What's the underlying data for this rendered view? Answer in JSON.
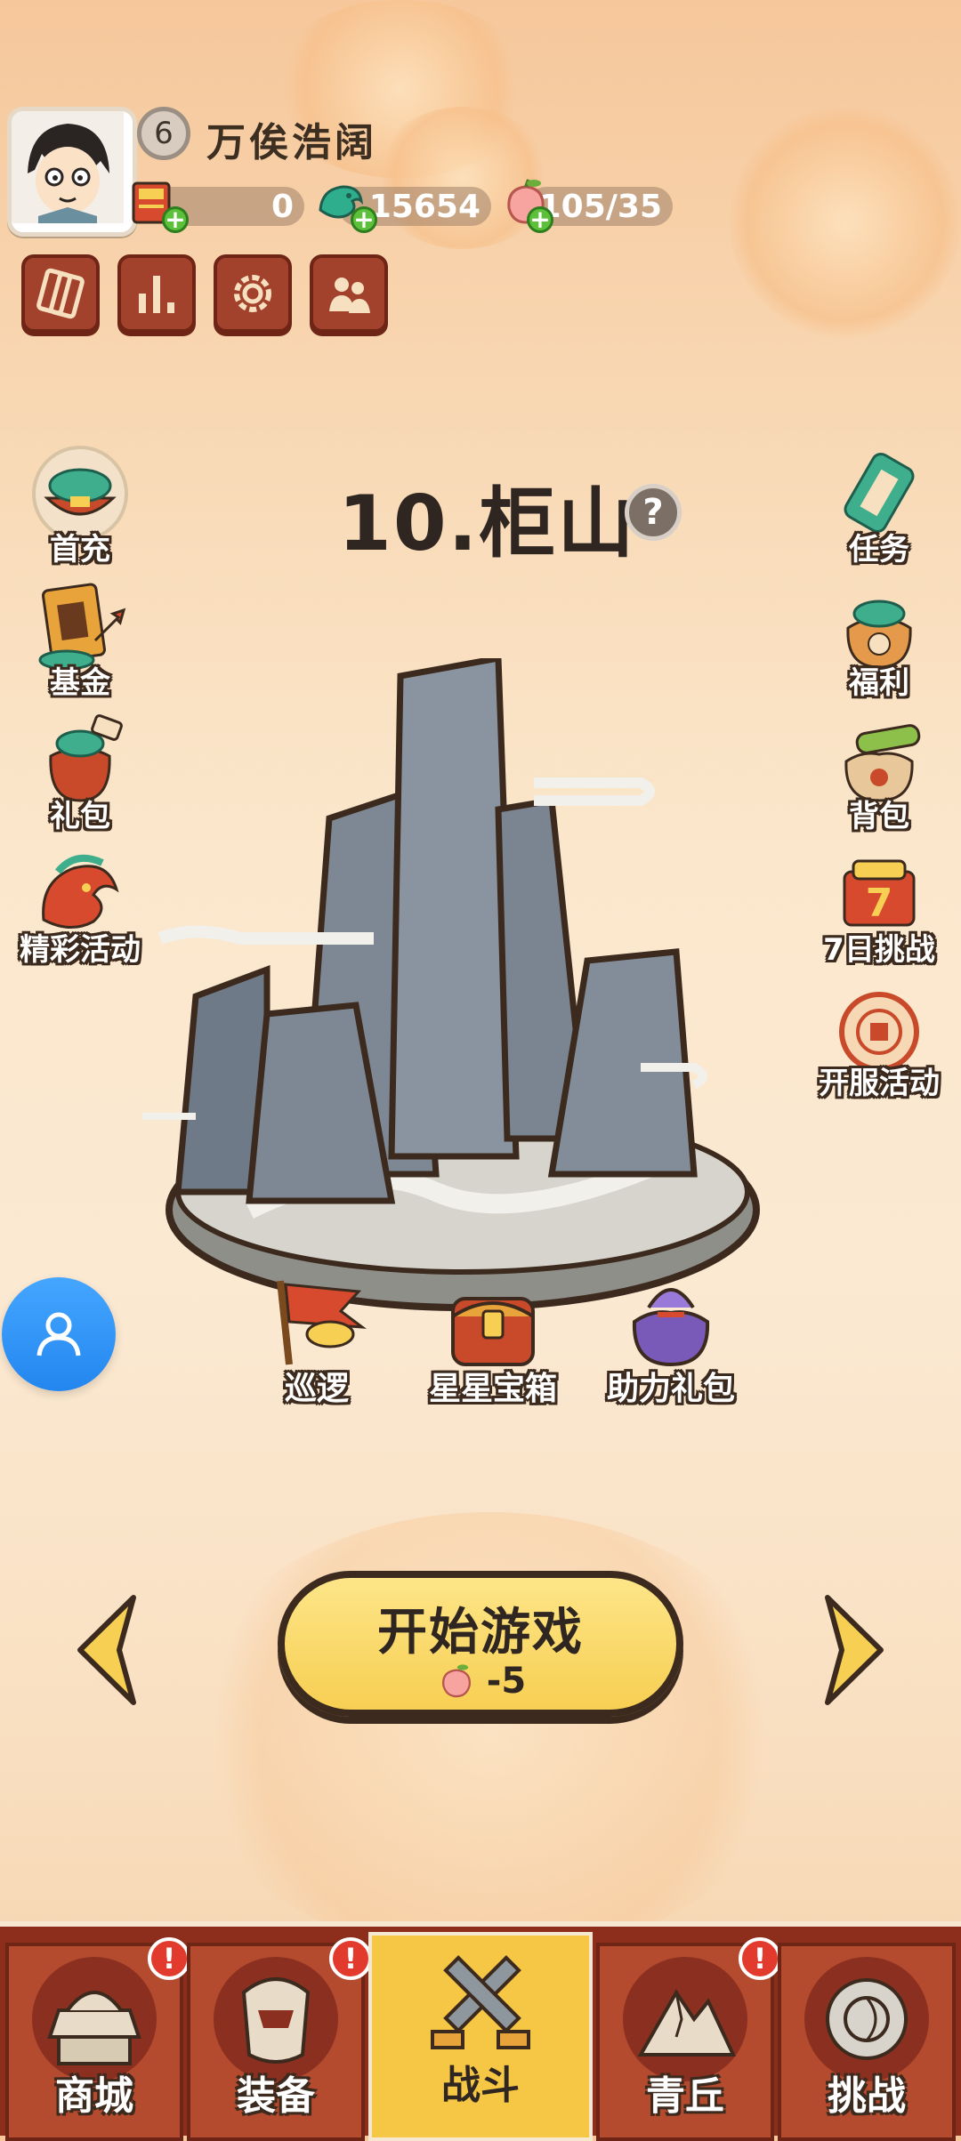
{
  "player": {
    "level": "6",
    "name": "万俟浩阔",
    "avatar_icon": "cartoon-boy-avatar"
  },
  "resources": [
    {
      "name": "scroll-ticket",
      "icon": "scroll-icon",
      "value": "0"
    },
    {
      "name": "jade-coin",
      "icon": "jade-dragon-icon",
      "value": "15654"
    },
    {
      "name": "peach-stamina",
      "icon": "peach-icon",
      "value": "105/35"
    }
  ],
  "top_menu": [
    "card-icon",
    "ranking-icon",
    "settings-gear-icon",
    "friends-icon"
  ],
  "left_buttons": [
    {
      "label": "首充",
      "icon": "treasure-bowl-icon"
    },
    {
      "label": "基金",
      "icon": "fund-book-icon"
    },
    {
      "label": "礼包",
      "icon": "gift-bag-icon"
    },
    {
      "label": "精彩活动",
      "icon": "dragon-event-icon"
    }
  ],
  "right_buttons": [
    {
      "label": "任务",
      "icon": "task-scroll-icon"
    },
    {
      "label": "福利",
      "icon": "welfare-bag-icon"
    },
    {
      "label": "背包",
      "icon": "backpack-icon"
    },
    {
      "label": "7日挑战",
      "icon": "seven-day-icon"
    },
    {
      "label": "开服活动",
      "icon": "server-open-icon"
    }
  ],
  "stage": {
    "title": "10.柜山",
    "art": "mountain-rocks-illustration"
  },
  "stage_actions": [
    {
      "label": "巡逻",
      "icon": "patrol-flag-icon"
    },
    {
      "label": "星星宝箱",
      "icon": "star-chest-icon"
    },
    {
      "label": "助力礼包",
      "icon": "assist-bag-icon"
    }
  ],
  "start": {
    "label": "开始游戏",
    "cost": "-5"
  },
  "nav": [
    {
      "label": "商城",
      "icon": "shop-icon",
      "badge": "!",
      "active": false
    },
    {
      "label": "装备",
      "icon": "armor-icon",
      "badge": "!",
      "active": false
    },
    {
      "label": "战斗",
      "icon": "crossed-swords-icon",
      "badge": "",
      "active": true
    },
    {
      "label": "青丘",
      "icon": "mountain-icon",
      "badge": "!",
      "active": false
    },
    {
      "label": "挑战",
      "icon": "challenge-gong-icon",
      "badge": "",
      "active": false
    }
  ],
  "colors": {
    "accent_red": "#a3422c",
    "start_yellow": "#f7cf52",
    "support_blue": "#2386ef",
    "badge_red": "#e23b2e"
  }
}
